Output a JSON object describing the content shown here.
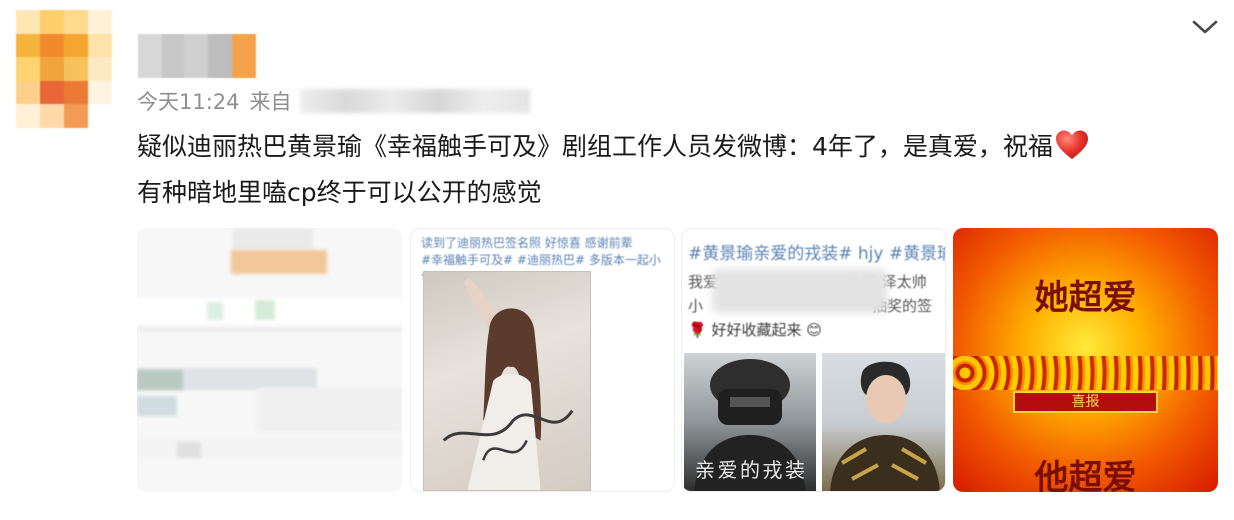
{
  "meta": {
    "time": "今天11:24",
    "source_prefix": "来自"
  },
  "post": {
    "line1": "疑似迪丽热巴黄景瑜《幸福触手可及》剧组工作人员发微博：4年了，是真爱，祝福",
    "line2": "有种暗地里嗑cp终于可以公开的感觉"
  },
  "images": {
    "tile2": {
      "caption_1": "读到了迪丽热巴签名照 好惊喜 感谢前辈",
      "caption_2": "#幸福触手可及# #迪丽热巴# 多版本一起小包好"
    },
    "tile3": {
      "hashtag": "#黄景瑜亲爱的戎装# hjy #黄景瑜",
      "line_a": "我爱",
      "line_b": "收藏 泽太帅",
      "line_c": "小",
      "line_d": "抽奖的签",
      "line_e": "好好收藏起来",
      "poster_text": "亲爱的戎装"
    },
    "tile4": {
      "top_text": "她超爱",
      "banner": "喜报",
      "bottom_text": "他超爱"
    }
  },
  "colors": {
    "accent_link": "#5b83b5",
    "meta_gray": "#8f8f8f",
    "heart": "#e8312a"
  }
}
